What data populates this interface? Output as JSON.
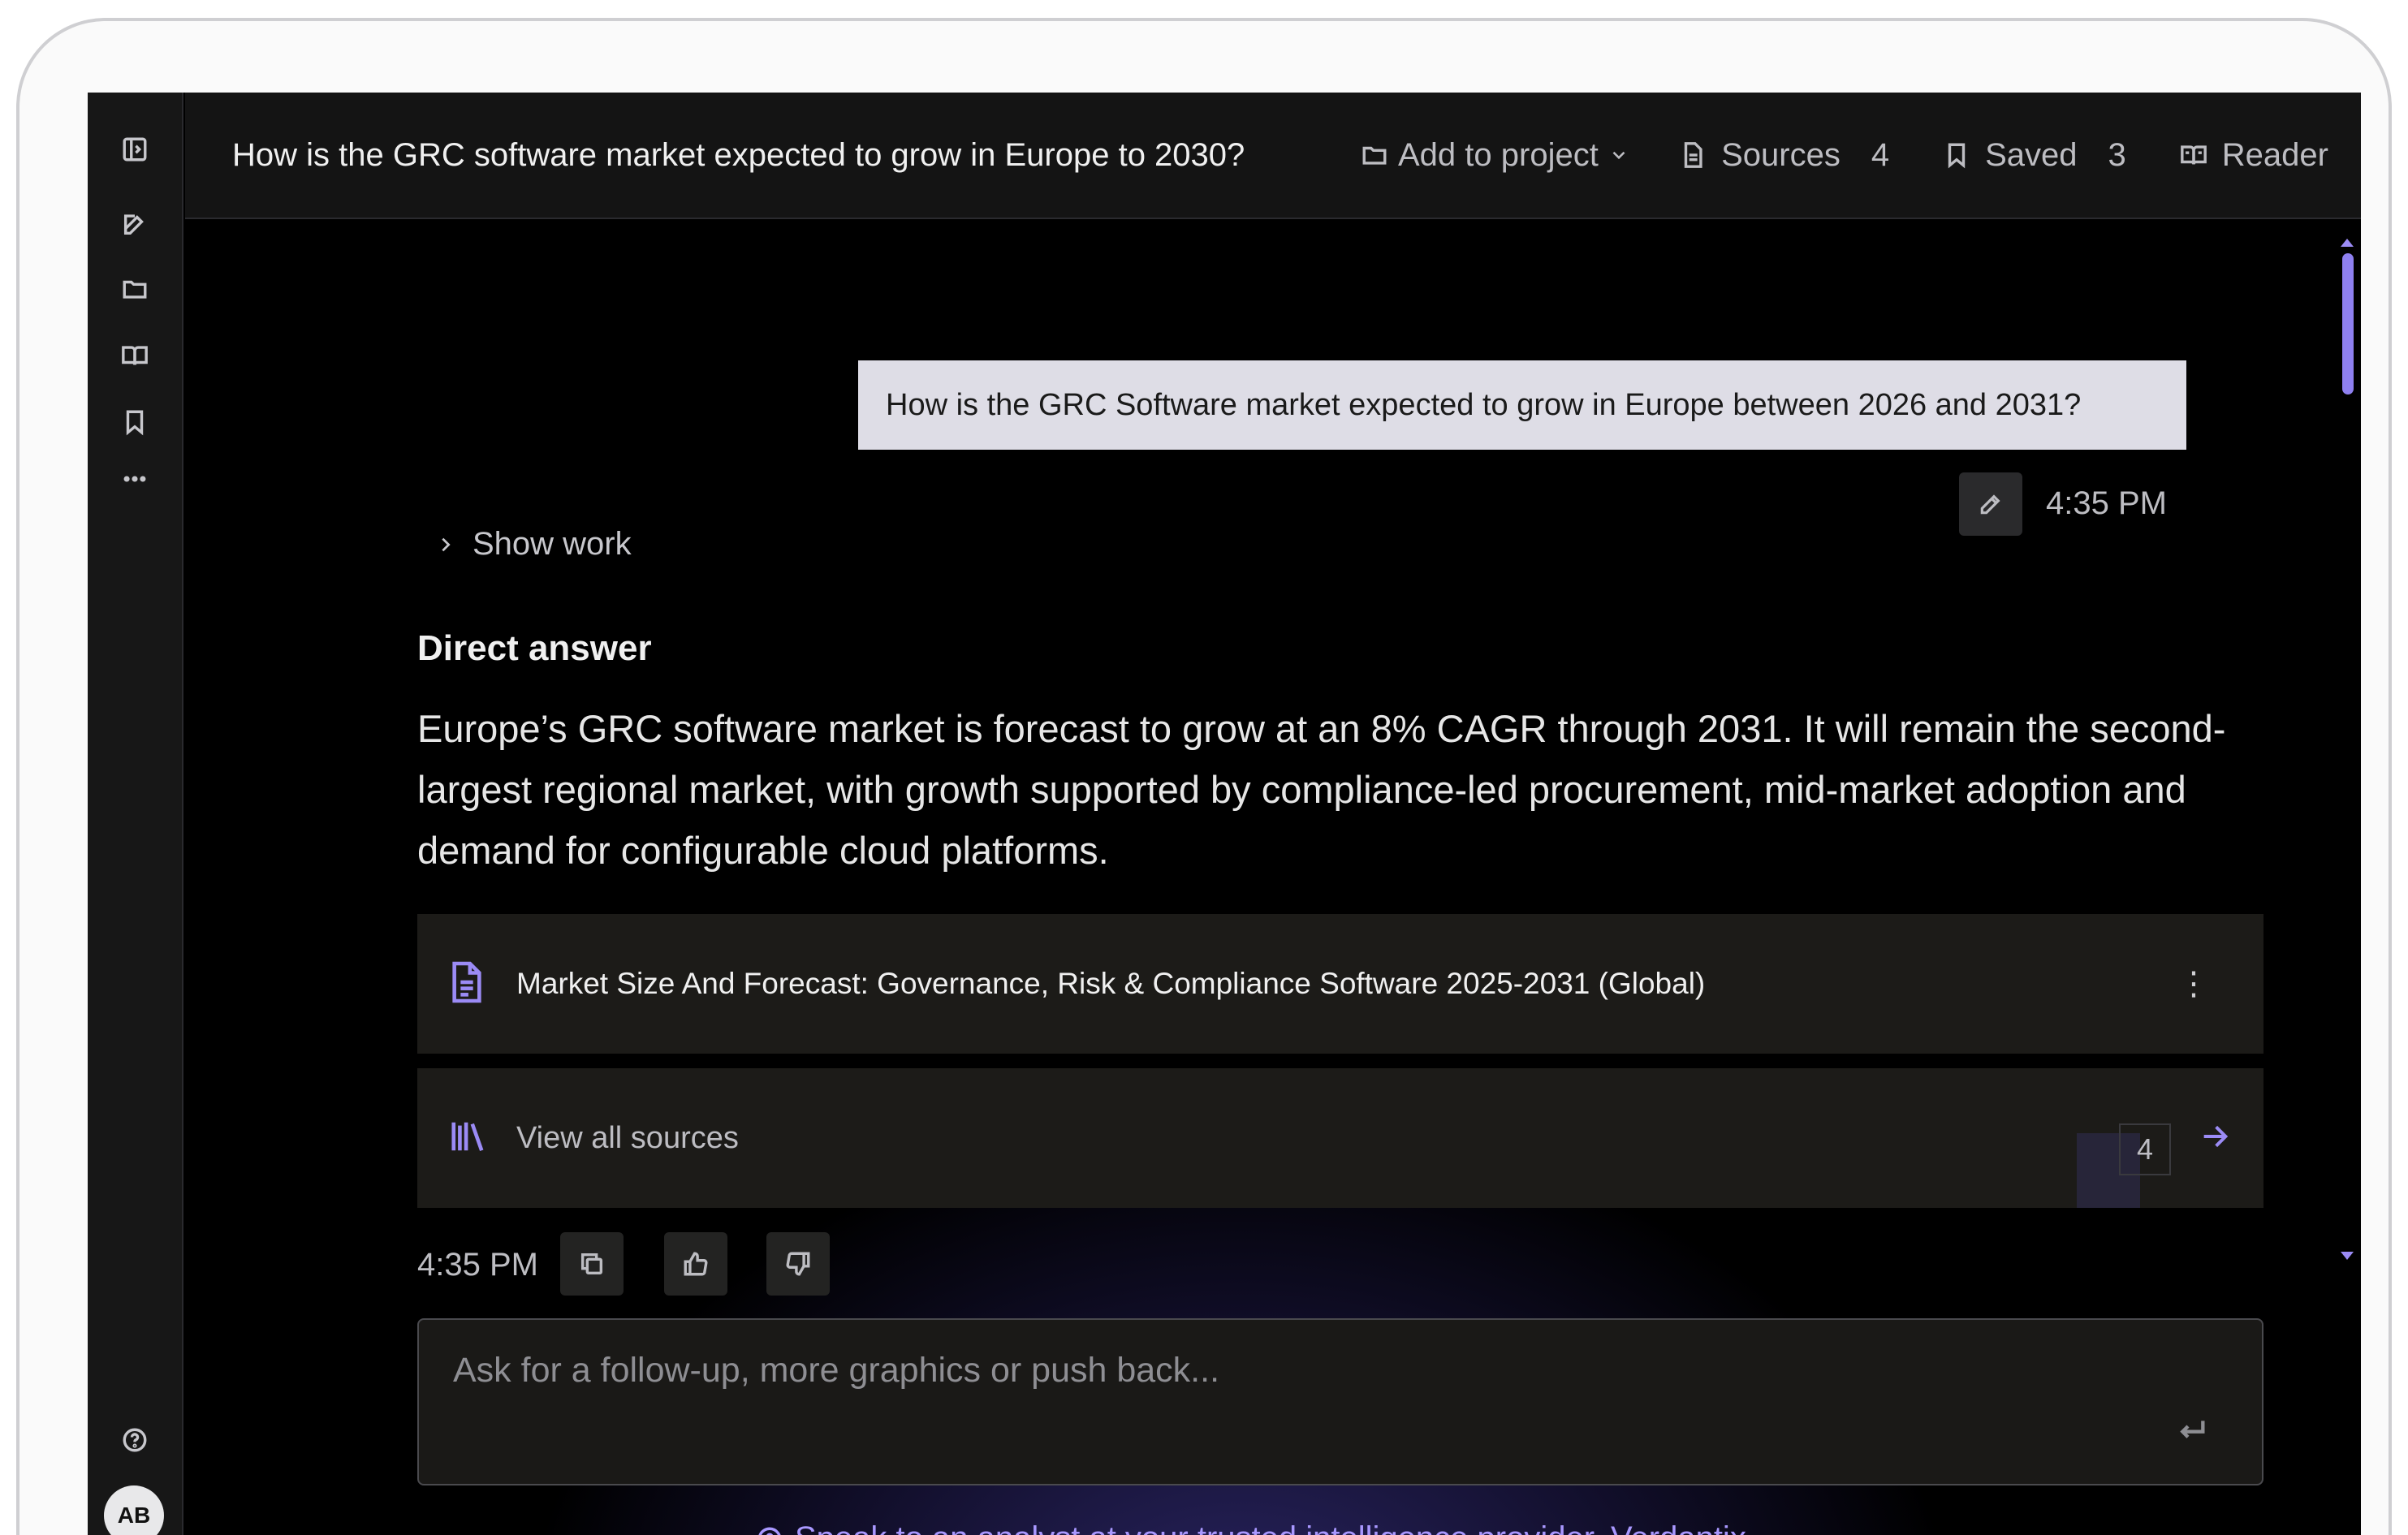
{
  "header": {
    "title": "How is the GRC software market expected to grow in Europe to 2030?",
    "add_to_project": "Add to project",
    "sources_label": "Sources",
    "sources_count": "4",
    "saved_label": "Saved",
    "saved_count": "3",
    "reader_label": "Reader"
  },
  "sidebar": {
    "icons": [
      "sidebar-toggle-icon",
      "new-chat-icon",
      "folder-icon",
      "book-icon",
      "bookmark-icon",
      "more-icon",
      "help-icon"
    ],
    "avatar_initials": "AB"
  },
  "conversation": {
    "user_question": "How is the GRC Software market expected to grow in Europe between 2026 and 2031?",
    "user_time": "4:35 PM",
    "show_work": "Show work",
    "answer_heading": "Direct answer",
    "answer_text": "Europe’s GRC software market is forecast to grow at an 8% CAGR through 2031. It will remain the second-largest regional market, with growth supported by compliance-led procurement, mid-market adoption and demand for configurable cloud platforms.",
    "source_title": "Market Size And Forecast: Governance, Risk & Compliance Software 2025-2031 (Global)",
    "view_all_sources": "View all sources",
    "sources_total": "4",
    "reply_time": "4:35 PM"
  },
  "composer": {
    "placeholder": "Ask for a follow-up, more graphics or push back..."
  },
  "footer": {
    "analyst_text": "Speak to an analyst at your trusted intelligence provider, Verdantix"
  },
  "colors": {
    "accent": "#9b8bf5",
    "background": "#000000",
    "panel": "#1c1b18"
  }
}
